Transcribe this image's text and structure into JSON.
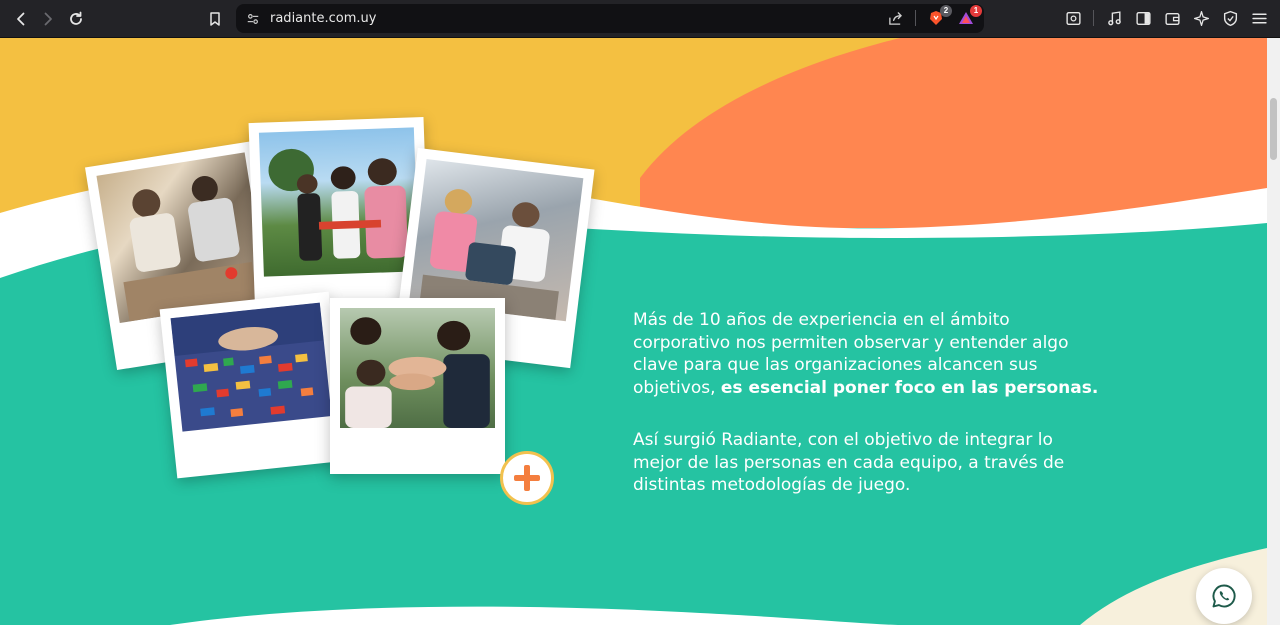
{
  "browser": {
    "url": "radiante.com.uy",
    "brave_badge": "2",
    "alert_badge": "1"
  },
  "content": {
    "paragraph_1_text": "Más de 10 años de experiencia en el ámbito corporativo nos permiten observar y entender algo clave para que las organizaciones alcancen sus objetivos, ",
    "paragraph_1_bold": "es esencial poner foco en las personas.",
    "paragraph_2_text": "Así surgió Radiante, con el objetivo de integrar lo mejor de las personas en cada equipo, a través de distintas metodologías de juego."
  },
  "icons": {
    "plus": "plus-icon",
    "whatsapp": "whatsapp-icon"
  },
  "colors": {
    "teal": "#25c3a2",
    "yellow": "#f4c041",
    "orange": "#ff8650",
    "cream": "#f7f0dc",
    "plus_orange": "#f47e3e"
  }
}
